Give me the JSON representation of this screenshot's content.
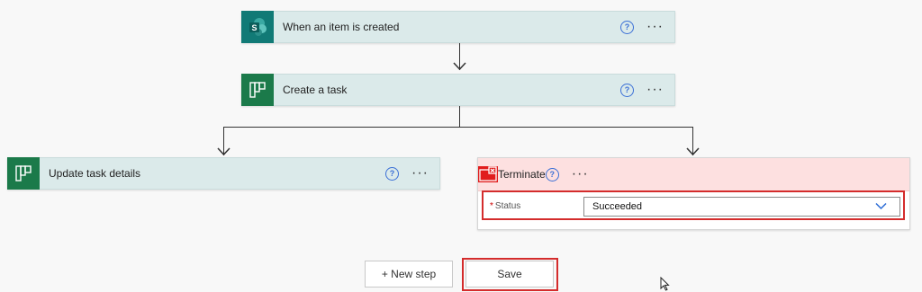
{
  "steps": {
    "trigger": {
      "title": "When an item is created",
      "icon": "sharepoint-icon"
    },
    "create_task": {
      "title": "Create a task",
      "icon": "planner-icon"
    },
    "update_task": {
      "title": "Update task details",
      "icon": "planner-icon"
    },
    "terminate": {
      "title": "Terminate",
      "icon": "terminate-icon",
      "status_label": "Status",
      "required_marker": "*",
      "status_value": "Succeeded"
    }
  },
  "help_glyph": "?",
  "more_glyph": "···",
  "sharepoint_letter": "S",
  "footer": {
    "new_step_label": "+ New step",
    "save_label": "Save"
  },
  "colors": {
    "card_bg": "#dbeaea",
    "planner_green": "#1b7a4a",
    "sharepoint_teal": "#117a76",
    "terminate_red": "#e11d1d",
    "terminate_header_bg": "#fde0e0",
    "highlight_red": "#d42c2c",
    "help_blue": "#3a6fd6"
  }
}
